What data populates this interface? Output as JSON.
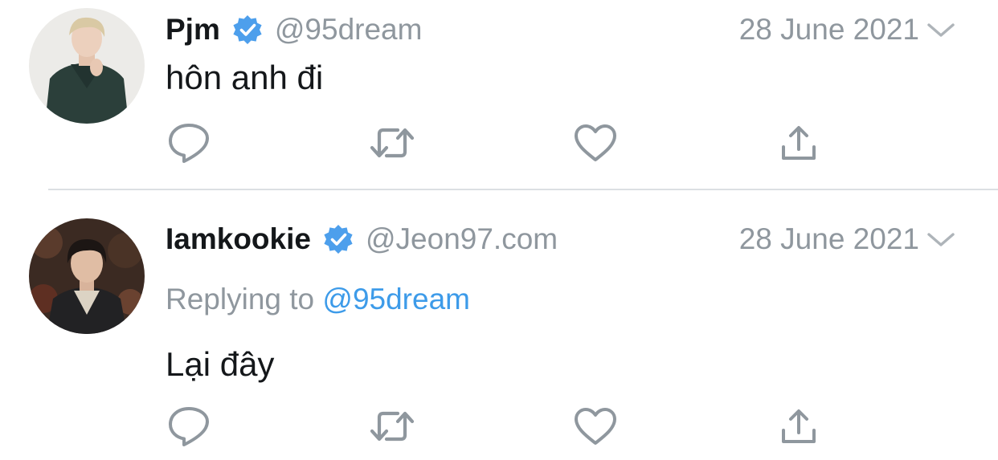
{
  "colors": {
    "text_primary": "#14171a",
    "text_secondary": "#8f979e",
    "link": "#3d9be9",
    "verified": "#4d9fec",
    "icon": "#8f979e",
    "divider": "#dcdfe3"
  },
  "tweets": [
    {
      "display_name": "Pjm",
      "verified": true,
      "handle": "@95dream",
      "date": "28 June 2021",
      "body": "hôn anh đi",
      "icons": [
        "avatar",
        "verified-badge-icon",
        "chevron-down-icon",
        "reply-icon",
        "retweet-icon",
        "like-icon",
        "share-icon"
      ]
    },
    {
      "display_name": "Iamkookie",
      "verified": true,
      "handle": "@Jeon97.com",
      "date": "28 June 2021",
      "replying_label": "Replying to",
      "replying_handle": "@95dream",
      "body": "Lại đây",
      "icons": [
        "avatar",
        "verified-badge-icon",
        "chevron-down-icon",
        "reply-icon",
        "retweet-icon",
        "like-icon",
        "share-icon"
      ]
    }
  ]
}
